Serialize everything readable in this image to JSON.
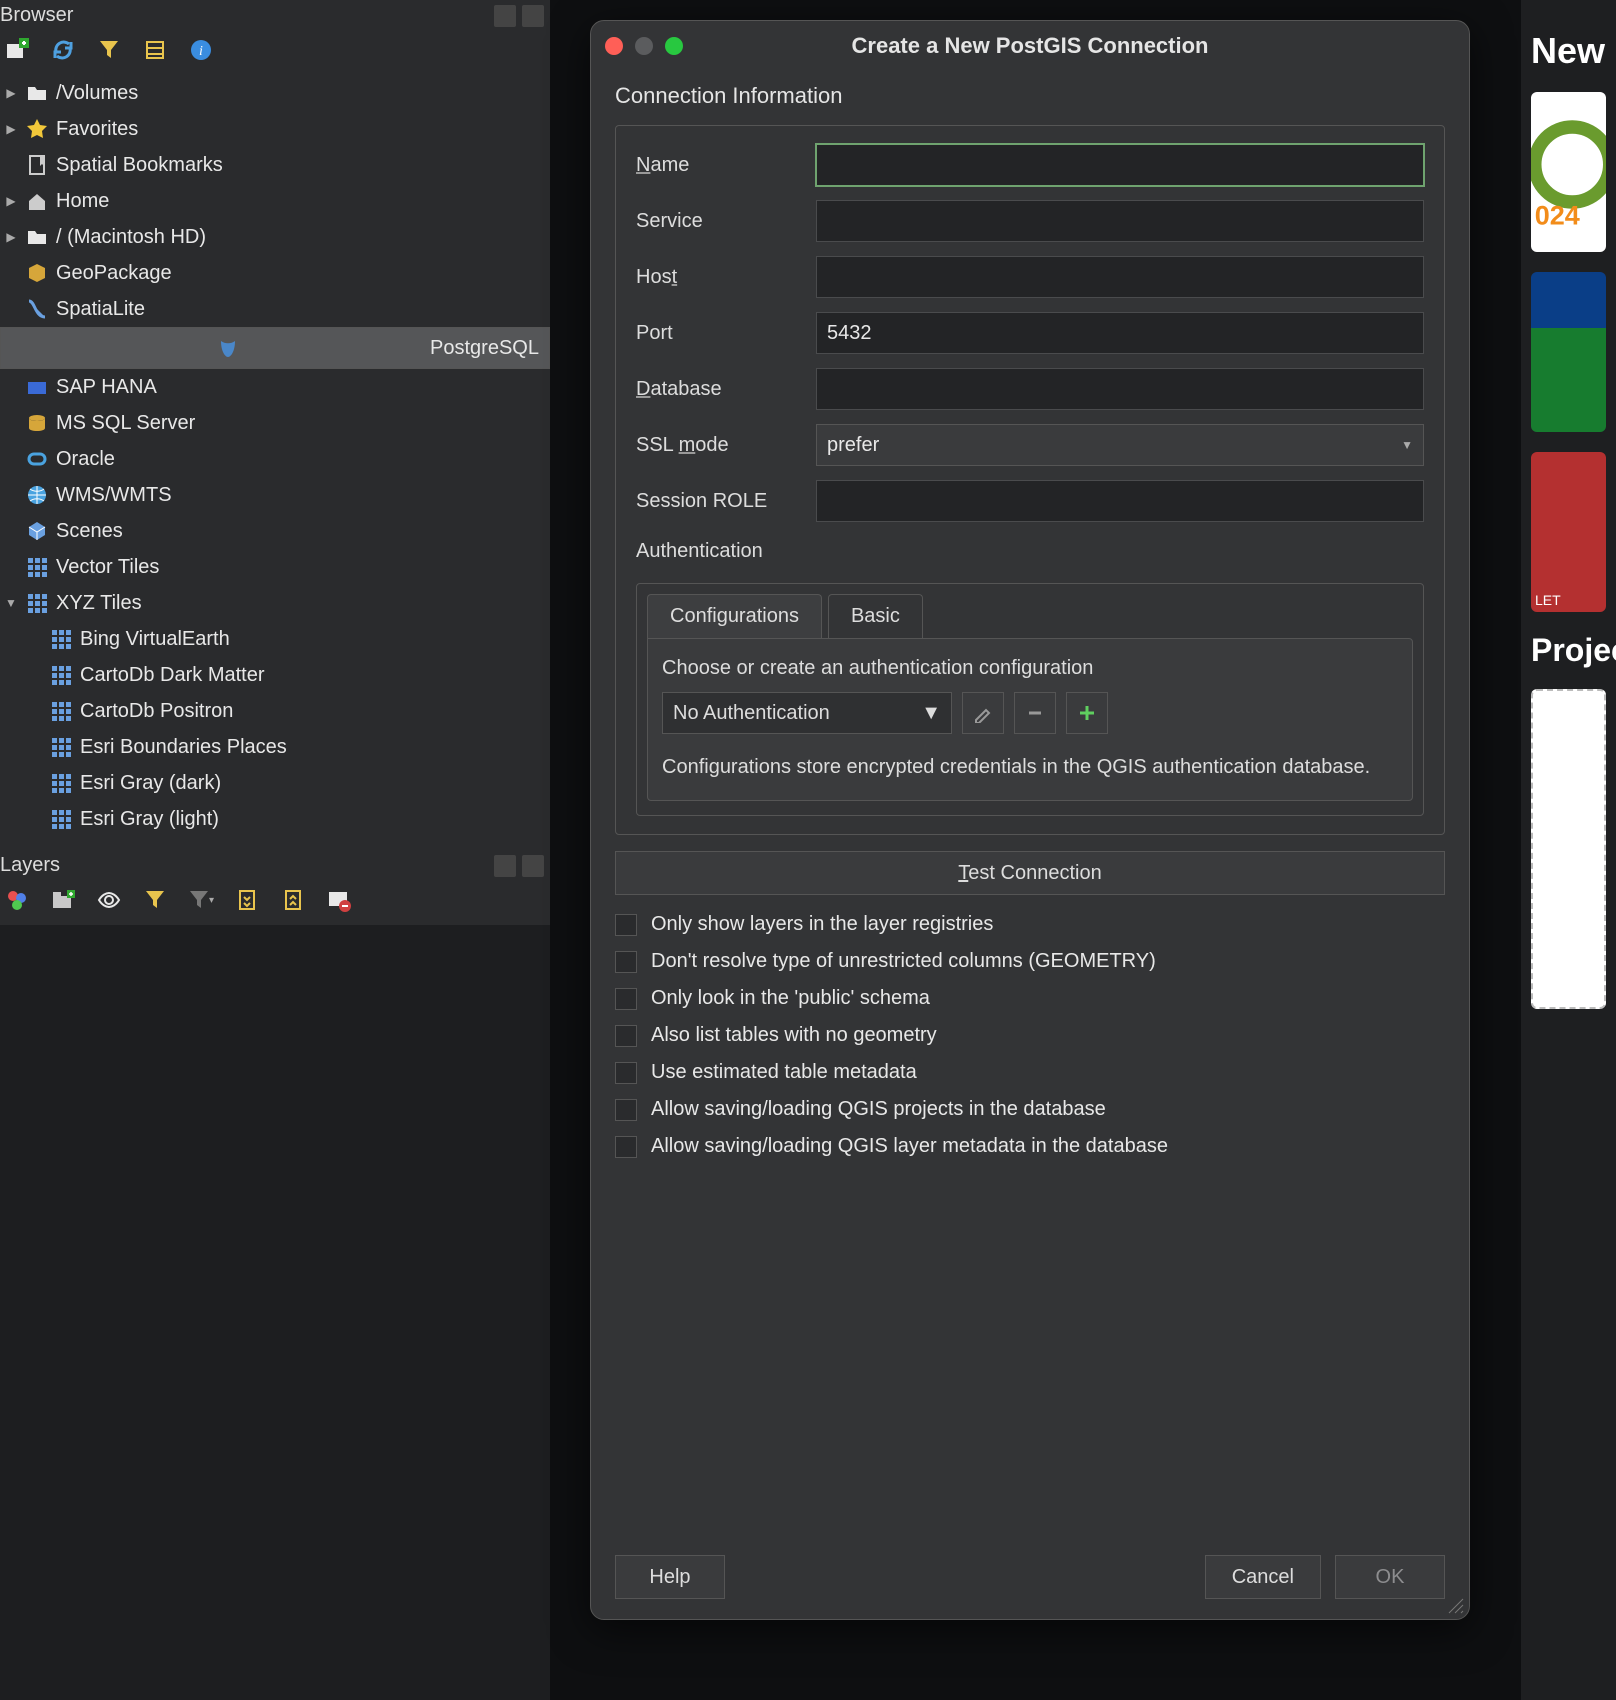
{
  "left": {
    "browser_title": "Browser",
    "layers_title": "Layers",
    "tree": [
      {
        "label": "/Volumes",
        "arrow": "right",
        "icon": "folder",
        "indent": 0
      },
      {
        "label": "Favorites",
        "arrow": "right",
        "icon": "star",
        "indent": 0
      },
      {
        "label": "Spatial Bookmarks",
        "arrow": "none",
        "icon": "bookmark",
        "indent": 0
      },
      {
        "label": "Home",
        "arrow": "right",
        "icon": "home",
        "indent": 0
      },
      {
        "label": "/ (Macintosh HD)",
        "arrow": "right",
        "icon": "folder",
        "indent": 0
      },
      {
        "label": "GeoPackage",
        "arrow": "none",
        "icon": "geopackage",
        "indent": 0
      },
      {
        "label": "SpatiaLite",
        "arrow": "none",
        "icon": "spatialite",
        "indent": 0
      },
      {
        "label": "PostgreSQL",
        "arrow": "none",
        "icon": "postgres",
        "indent": 0,
        "selected": true
      },
      {
        "label": "SAP HANA",
        "arrow": "none",
        "icon": "saphana",
        "indent": 0
      },
      {
        "label": "MS SQL Server",
        "arrow": "none",
        "icon": "mssql",
        "indent": 0
      },
      {
        "label": "Oracle",
        "arrow": "none",
        "icon": "oracle",
        "indent": 0
      },
      {
        "label": "WMS/WMTS",
        "arrow": "none",
        "icon": "wms",
        "indent": 0
      },
      {
        "label": "Scenes",
        "arrow": "none",
        "icon": "scenes",
        "indent": 0
      },
      {
        "label": "Vector Tiles",
        "arrow": "none",
        "icon": "grid",
        "indent": 0
      },
      {
        "label": "XYZ Tiles",
        "arrow": "down",
        "icon": "grid",
        "indent": 0
      },
      {
        "label": "Bing VirtualEarth",
        "arrow": "none",
        "icon": "grid",
        "indent": 1
      },
      {
        "label": "CartoDb Dark Matter",
        "arrow": "none",
        "icon": "grid",
        "indent": 1
      },
      {
        "label": "CartoDb Positron",
        "arrow": "none",
        "icon": "grid",
        "indent": 1
      },
      {
        "label": "Esri Boundaries Places",
        "arrow": "none",
        "icon": "grid",
        "indent": 1
      },
      {
        "label": "Esri Gray (dark)",
        "arrow": "none",
        "icon": "grid",
        "indent": 1
      },
      {
        "label": "Esri Gray (light)",
        "arrow": "none",
        "icon": "grid",
        "indent": 1
      }
    ]
  },
  "dialog": {
    "title": "Create a New PostGIS Connection",
    "section": "Connection Information",
    "fields": {
      "name_label": "Name",
      "service_label": "Service",
      "host_label": "Host",
      "port_label": "Port",
      "port_value": "5432",
      "database_label": "Database",
      "sslmode_label": "SSL mode",
      "sslmode_value": "prefer",
      "sessionrole_label": "Session ROLE"
    },
    "auth": {
      "title": "Authentication",
      "tab_config": "Configurations",
      "tab_basic": "Basic",
      "hint": "Choose or create an authentication configuration",
      "dropdown": "No Authentication",
      "desc": "Configurations store encrypted credentials in the QGIS authentication database."
    },
    "test_btn": "Test Connection",
    "checks": [
      "Only show layers in the layer registries",
      "Don't resolve type of unrestricted columns (GEOMETRY)",
      "Only look in the 'public' schema",
      "Also list tables with no geometry",
      "Use estimated table metadata",
      "Allow saving/loading QGIS projects in the database",
      "Allow saving/loading QGIS layer metadata in the database"
    ],
    "buttons": {
      "help": "Help",
      "cancel": "Cancel",
      "ok": "OK"
    }
  },
  "right": {
    "new": "New",
    "proj": "Projects",
    "let": "LET"
  }
}
